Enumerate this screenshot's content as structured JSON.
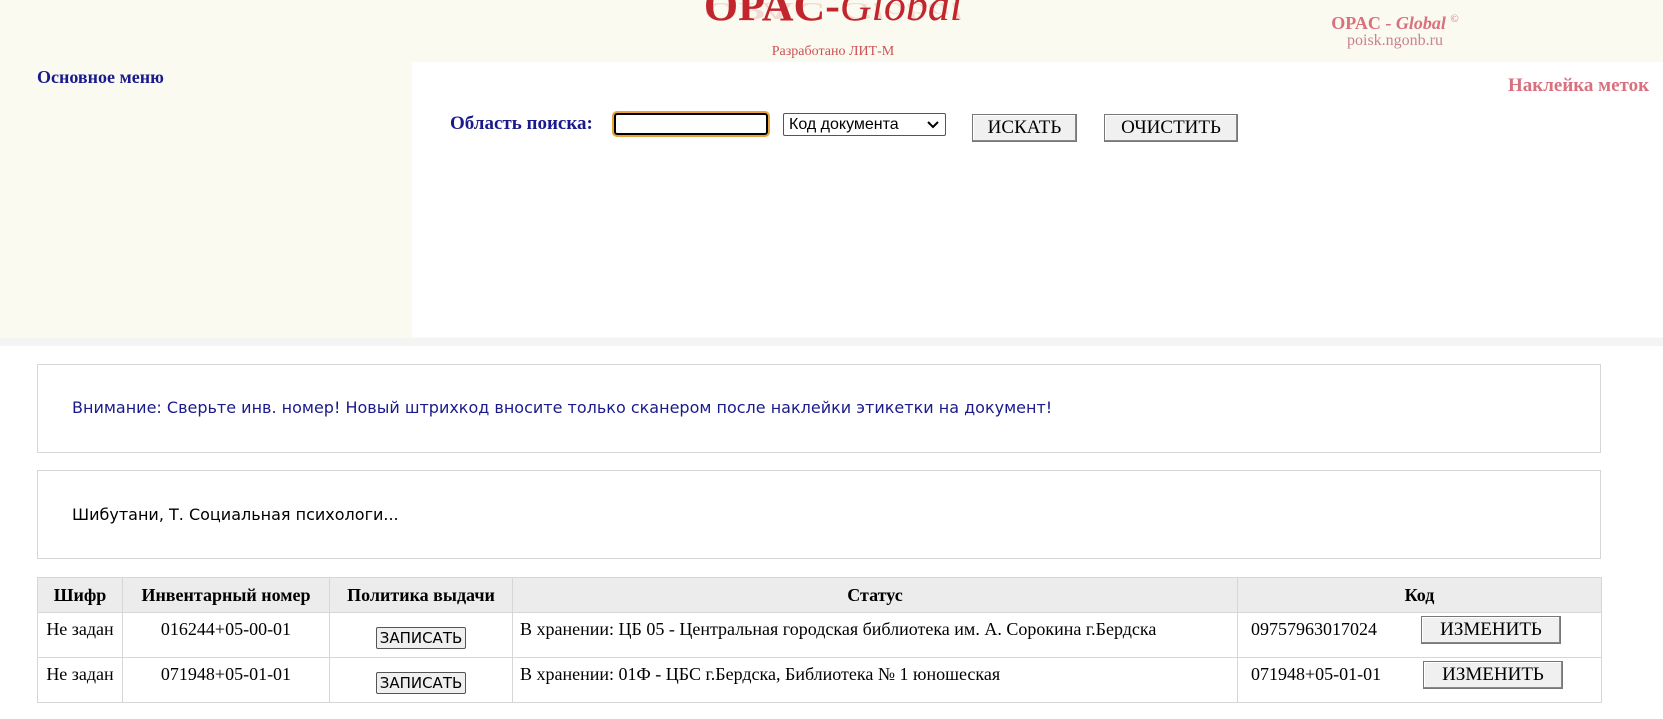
{
  "header": {
    "logo_main": "OPAC-",
    "logo_italic": "Global",
    "logo_sub": "Разработано ЛИТ-М",
    "brand_prefix": "OPAC - ",
    "brand_italic": "Global",
    "brand_copyright": "©",
    "brand_url": "poisk.ngonb.ru"
  },
  "menu": {
    "main_menu_label": "Основное меню"
  },
  "search": {
    "section_title": "Наклейка меток",
    "label": "Область поиска:",
    "input_value": "",
    "select_value": "Код документа",
    "search_button": "ИСКАТЬ",
    "clear_button": "ОЧИСТИТЬ"
  },
  "notice": {
    "warning": "Внимание: Сверьте инв. номер! Новый штрихкод вносите только сканером после наклейки этикетки на документ!"
  },
  "document": {
    "title": "Шибутани, Т. Социальная психологи..."
  },
  "table": {
    "headers": {
      "shelf": "Шифр",
      "inventory": "Инвентарный номер",
      "policy": "Политика выдачи",
      "status": "Статус",
      "code": "Код"
    },
    "rows": [
      {
        "shelf": "Не задан",
        "inventory": "016244+05-00-01",
        "policy_button": "ЗАПИСАТЬ",
        "status": "В хранении: ЦБ 05 - Центральная городская библиотека им. А. Сорокина г.Бердска",
        "code": "09757963017024",
        "change_button": "ИЗМЕНИТЬ"
      },
      {
        "shelf": "Не задан",
        "inventory": "071948+05-01-01",
        "policy_button": "ЗАПИСАТЬ",
        "status": "В хранении: 01Ф - ЦБС г.Бердска, Библиотека № 1 юношеская",
        "code": "071948+05-01-01",
        "change_button": "ИЗМЕНИТЬ"
      }
    ]
  }
}
